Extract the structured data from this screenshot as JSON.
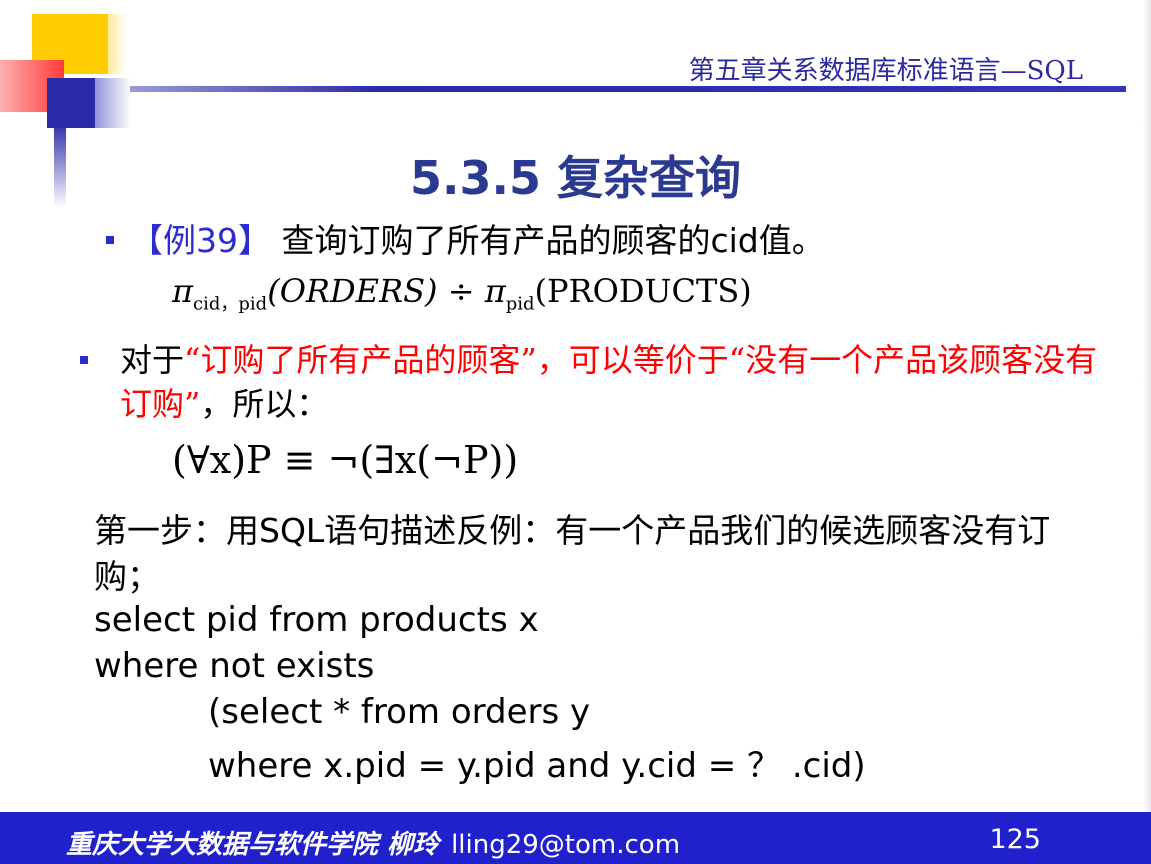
{
  "header": {
    "chapter_title": "第五章关系数据库标准语言—SQL"
  },
  "slide_title": "5.3.5 复杂查询",
  "example": {
    "tag": "【例39】",
    "text": " 查询订购了所有产品的顾客的cid值。"
  },
  "formula1": {
    "pi1": "π",
    "sub1": "cid，pid",
    "arg1": "(ORDERS)",
    "op": " ÷ ",
    "pi2": "π",
    "sub2": "pid",
    "arg2": "(PRODUCTS)"
  },
  "para2": {
    "part1": "对于",
    "quote1": "“订购了所有产品的顾客”，可以等价于“没有一个产品该顾客没有订购”",
    "part2": "，所以："
  },
  "formula2": "(∀x)P ≡ ¬(∃x(¬P))",
  "step1": "第一步：用SQL语句描述反例：有一个产品我们的候选顾客没有订购；",
  "code_lines": [
    "select pid from products x",
    "where not exists",
    "(select * from orders y",
    "where x.pid = y.pid and y.cid = ？ .cid)"
  ],
  "footer": {
    "institution": "重庆大学大数据与软件学院  柳玲",
    "email": "lling29@tom.com",
    "page_number": "125"
  },
  "colors": {
    "accent_blue": "#2b2b9e",
    "highlight_red": "#ff0000",
    "footer_bg": "#2020cc"
  }
}
